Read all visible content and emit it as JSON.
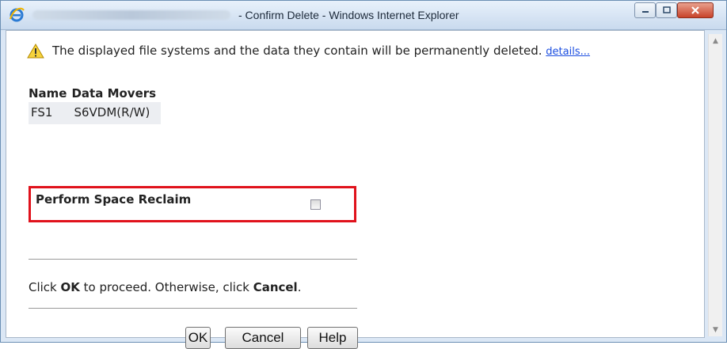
{
  "window": {
    "title": "- Confirm Delete - Windows Internet Explorer",
    "controls": {
      "minimize": "minimize",
      "maximize": "maximize",
      "close": "close"
    }
  },
  "dialog": {
    "warning_message": "The displayed file systems and the data they contain will be permanently deleted.",
    "details_link": "details...",
    "table": {
      "headers": [
        "Name",
        "Data Movers"
      ],
      "rows": [
        [
          "FS1",
          "S6VDM(R/W)"
        ]
      ]
    },
    "space_reclaim_label": "Perform Space Reclaim",
    "space_reclaim_checked": false,
    "instruction": {
      "part1": "Click ",
      "ok_word": "OK",
      "part2": " to proceed. Otherwise, click ",
      "cancel_word": "Cancel",
      "part3": "."
    },
    "buttons": {
      "ok": "OK",
      "cancel": "Cancel",
      "help": "Help"
    }
  },
  "colors": {
    "highlight_border": "#e0121c",
    "link": "#1b4ee0",
    "close_button": "#c8432a"
  }
}
